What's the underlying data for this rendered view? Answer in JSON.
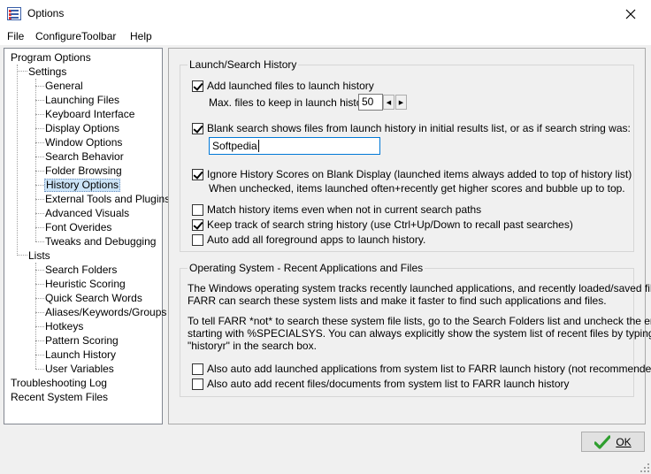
{
  "window": {
    "title": "Options"
  },
  "menu": [
    {
      "label": "File"
    },
    {
      "label": "ConfigureToolbar"
    },
    {
      "label": "Help"
    }
  ],
  "tree": {
    "root": "Program Options",
    "settings": "Settings",
    "settings_items": [
      "General",
      "Launching Files",
      "Keyboard Interface",
      "Display Options",
      "Window Options",
      "Search Behavior",
      "Folder Browsing",
      "History Options",
      "External Tools and Plugins",
      "Advanced Visuals",
      "Font Overides",
      "Tweaks and Debugging"
    ],
    "lists": "Lists",
    "lists_items": [
      "Search Folders",
      "Heuristic Scoring",
      "Quick Search Words",
      "Aliases/Keywords/Groups",
      "Hotkeys",
      "Pattern Scoring",
      "Launch History",
      "User Variables"
    ],
    "troubleshooting": "Troubleshooting Log",
    "recent": "Recent System Files",
    "selected": "History Options"
  },
  "launch_group": {
    "title": "Launch/Search History",
    "add_launched": {
      "label": "Add launched files to launch history",
      "checked": true
    },
    "max_files_label": "Max. files to keep in launch history:",
    "max_files_value": "50",
    "blank_search": {
      "label": "Blank search shows files from launch history in initial results list, or as if search string was:",
      "checked": true
    },
    "search_string_value": "Softpedia",
    "ignore_scores": {
      "label": "Ignore History Scores on Blank Display (launched items always added to top of history list)",
      "checked": true
    },
    "ignore_scores_note": "When unchecked, items launched often+recently get higher scores and bubble up to top.",
    "match_items": {
      "label": "Match history items even when not in current search paths",
      "checked": false
    },
    "keep_track": {
      "label": "Keep track of search string history (use Ctrl+Up/Down to recall past searches)",
      "checked": true
    },
    "auto_add_fg": {
      "label": "Auto add all foreground apps to launch history.",
      "checked": false
    }
  },
  "os_group": {
    "title": "Operating System - Recent Applications and Files",
    "para1_line1": "The Windows operating system tracks recently launched applications, and recently loaded/saved files.",
    "para1_line2": "FARR can search these system lists and make it faster to find such applications and files.",
    "para2_line1": "To tell FARR *not* to search these system file lists, go to the Search Folders list and uncheck the entries",
    "para2_line2": "starting with %SPECIALSYS.  You can always explicitly show the system list of recent files by typing",
    "para2_line3": "\"historyr\" in the search box.",
    "auto_apps": {
      "label": "Also auto add launched applications from system list to FARR launch history (not recommended)",
      "checked": false
    },
    "auto_docs": {
      "label": "Also auto add recent files/documents from system list to FARR launch history",
      "checked": false
    }
  },
  "buttons": {
    "ok_label": "OK"
  },
  "colors": {
    "selection": "#cce4f7",
    "ok_check": "#2e9e2e",
    "focus_border": "#0078d7"
  }
}
